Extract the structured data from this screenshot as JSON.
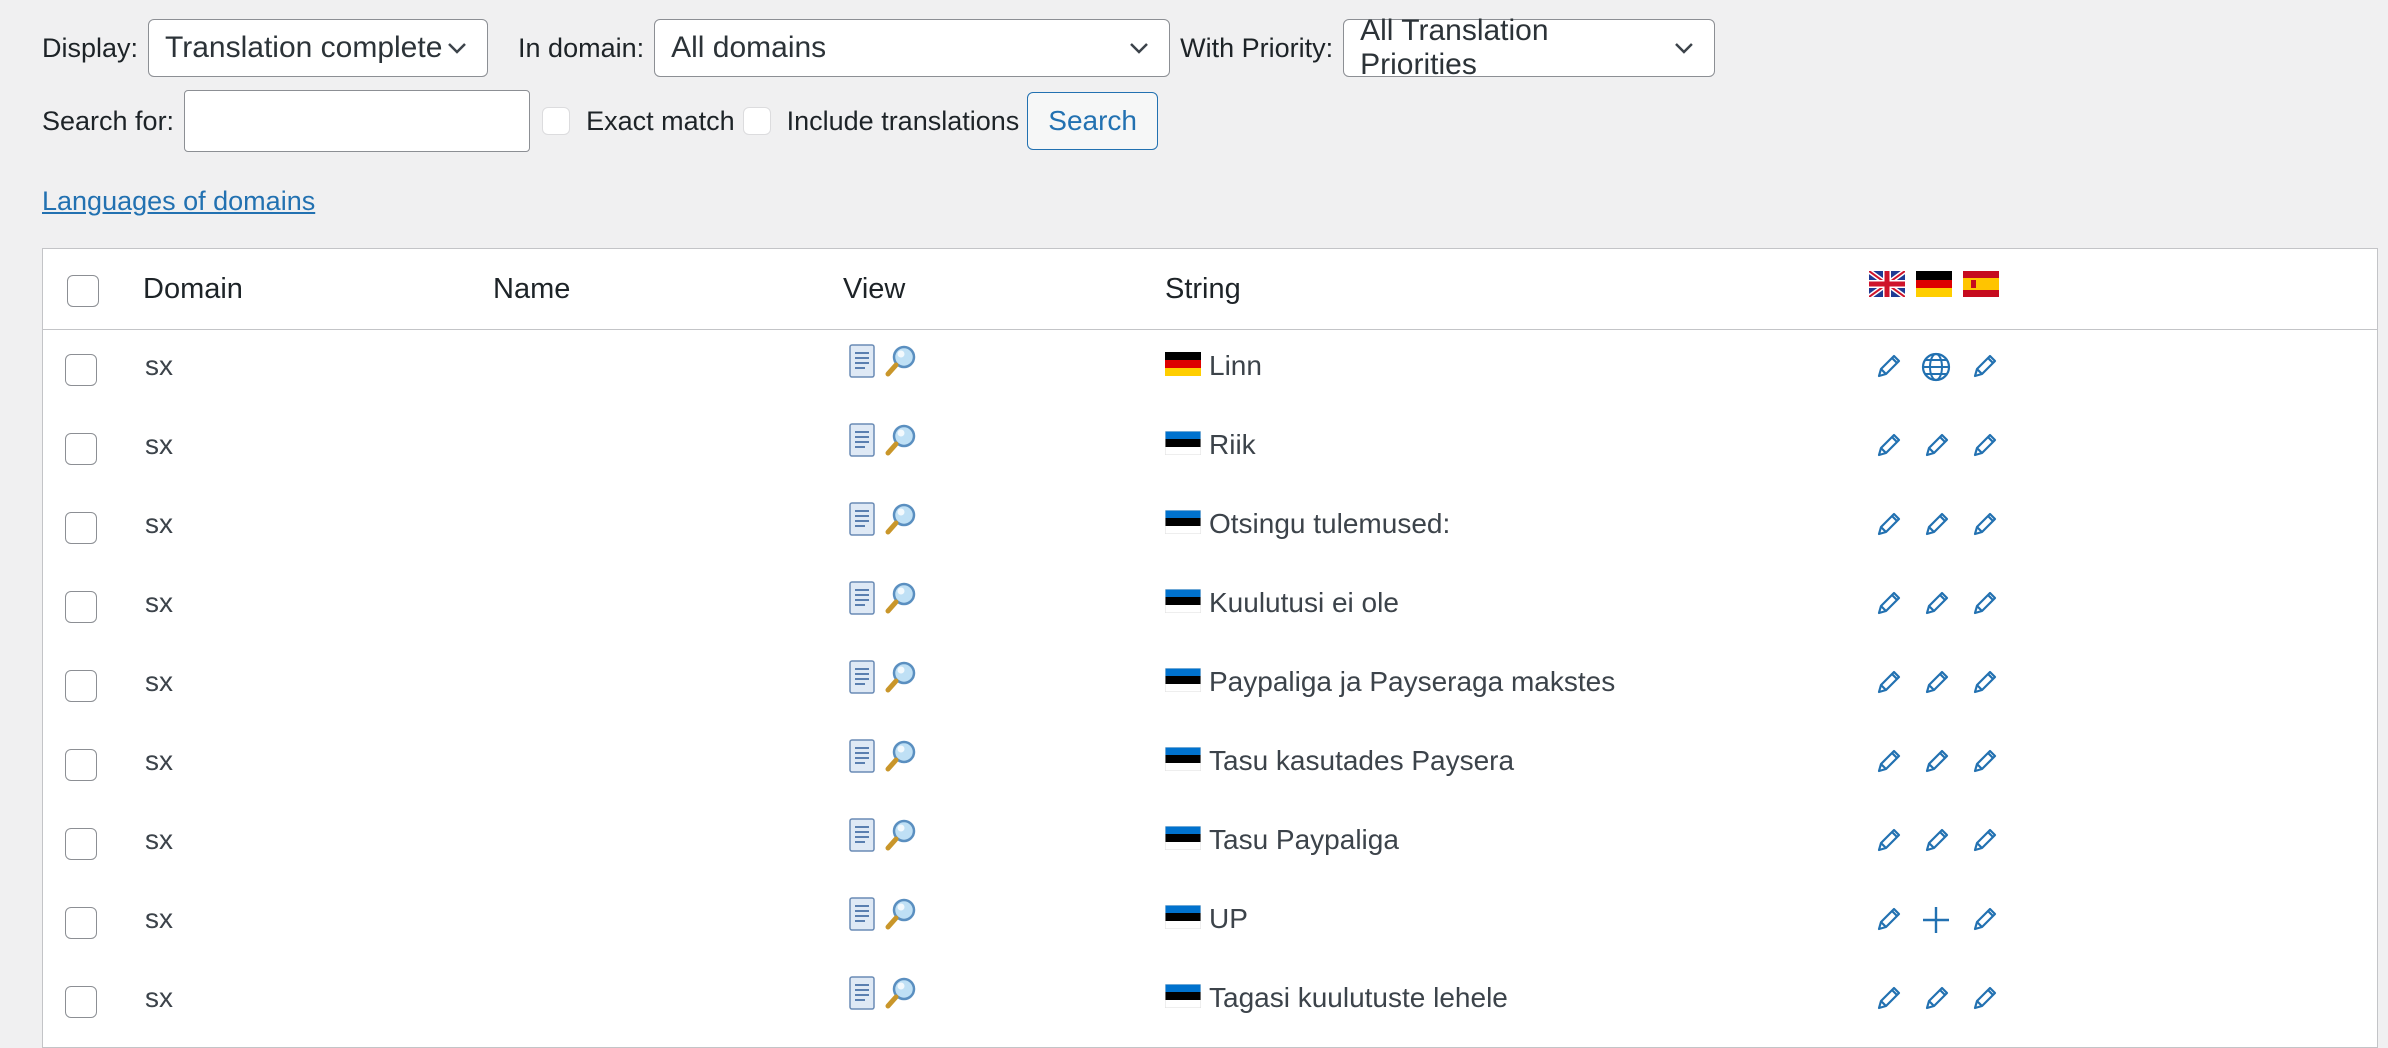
{
  "filters": {
    "display_label": "Display:",
    "display_value": "Translation complete",
    "domain_label": "In domain:",
    "domain_value": "All domains",
    "priority_label": "With Priority:",
    "priority_value": "All Translation Priorities",
    "search_label": "Search for:",
    "search_value": "",
    "exact_match_label": "Exact match",
    "include_translations_label": "Include translations",
    "search_button": "Search"
  },
  "languages_link": "Languages of domains",
  "table": {
    "headers": {
      "domain": "Domain",
      "name": "Name",
      "view": "View",
      "string": "String"
    },
    "header_languages": [
      "English",
      "German",
      "Spanish"
    ],
    "rows": [
      {
        "domain": "sx",
        "name": "",
        "flag": "German",
        "string": "Linn",
        "status": [
          "edit",
          "globe",
          "edit"
        ]
      },
      {
        "domain": "sx",
        "name": "",
        "flag": "Estonian",
        "string": "Riik",
        "status": [
          "edit",
          "edit",
          "edit"
        ]
      },
      {
        "domain": "sx",
        "name": "",
        "flag": "Estonian",
        "string": "Otsingu tulemused:",
        "status": [
          "edit",
          "edit",
          "edit"
        ]
      },
      {
        "domain": "sx",
        "name": "",
        "flag": "Estonian",
        "string": "Kuulutusi ei ole",
        "status": [
          "edit",
          "edit",
          "edit"
        ]
      },
      {
        "domain": "sx",
        "name": "",
        "flag": "Estonian",
        "string": "Paypaliga ja Payseraga makstes",
        "status": [
          "edit",
          "edit",
          "edit"
        ]
      },
      {
        "domain": "sx",
        "name": "",
        "flag": "Estonian",
        "string": "Tasu kasutades Paysera",
        "status": [
          "edit",
          "edit",
          "edit"
        ]
      },
      {
        "domain": "sx",
        "name": "",
        "flag": "Estonian",
        "string": "Tasu Paypaliga",
        "status": [
          "edit",
          "edit",
          "edit"
        ]
      },
      {
        "domain": "sx",
        "name": "",
        "flag": "Estonian",
        "string": "UP",
        "status": [
          "edit",
          "add",
          "edit"
        ]
      },
      {
        "domain": "sx",
        "name": "",
        "flag": "Estonian",
        "string": "Tagasi kuulutuste lehele",
        "status": [
          "edit",
          "edit",
          "edit"
        ]
      }
    ]
  },
  "colors": {
    "accent": "#2271b1",
    "text": "#3c434a",
    "background": "#f0f0f1"
  }
}
